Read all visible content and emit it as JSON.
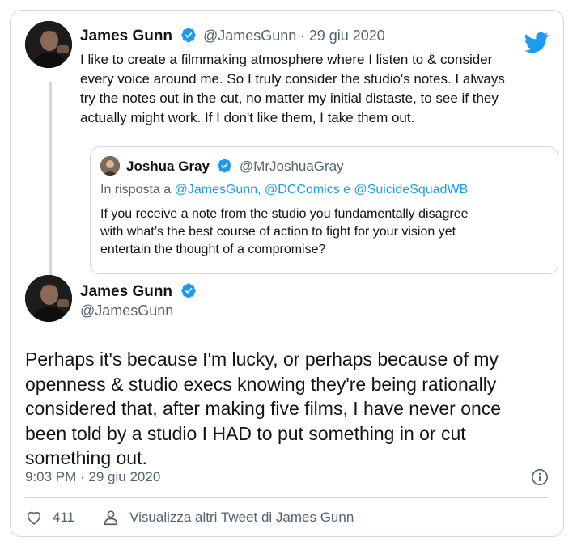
{
  "brand": {
    "twitter_blue": "#1d9bf0",
    "text": "#0f1419",
    "muted": "#536471"
  },
  "parent_tweet": {
    "author_name": "James Gunn",
    "author_handle": "@JamesGunn",
    "date": "· 29 giu 2020",
    "text_lines": [
      "I like to create a filmmaking atmosphere where I listen to & consider",
      "every voice around me. So I truly consider the studio's notes. I always",
      "try the notes out in the cut, no matter my initial distaste, to see if they",
      "actually might work. If I don't like them, I take them out."
    ]
  },
  "quoted_tweet": {
    "author_name": "Joshua Gray",
    "author_handle": "@MrJoshuaGray",
    "reply_prefix": "In risposta a",
    "reply_targets": "@JamesGunn, @DCComics e @SuicideSquadWB",
    "text_lines": [
      "If you receive a note from the studio you fundamentally disagree",
      "with what’s the best course of action to fight for your vision yet",
      "entertain the thought of a compromise?"
    ]
  },
  "main_tweet": {
    "author_name": "James Gunn",
    "author_handle": "@JamesGunn",
    "text_lines": [
      "Perhaps it's because I'm lucky, or perhaps because of my",
      "openness & studio execs knowing they're being rationally",
      "considered that, after making five films, I have never once",
      "been told by a studio I HAD to put something in or cut",
      "something out."
    ],
    "timestamp": "9:03 PM · 29 giu 2020",
    "like_count": "411",
    "more_tweets_label": "Visualizza altri Tweet di James Gunn"
  },
  "icons": [
    "twitter-bird-icon",
    "verified-badge-icon",
    "info-icon",
    "heart-icon",
    "person-icon"
  ]
}
